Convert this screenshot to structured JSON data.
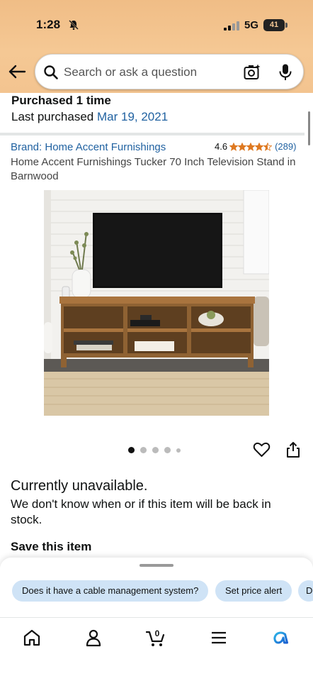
{
  "status_bar": {
    "time": "1:28",
    "network": "5G",
    "battery": "41"
  },
  "search": {
    "placeholder": "Search or ask a question",
    "value": ""
  },
  "purchase": {
    "count_text": "Purchased 1 time",
    "last_label": "Last purchased",
    "last_date": "Mar 19, 2021"
  },
  "product": {
    "brand": "Brand: Home Accent Furnishings",
    "rating_value": "4.6",
    "rating_stars": 4.5,
    "rating_count": "(289)",
    "title": "Home Accent Furnishings Tucker 70 Inch Television Stand in Barnwood",
    "image_count": 5,
    "active_image": 0
  },
  "availability": {
    "title": "Currently unavailable.",
    "text": "We don't know when or if this item will be back in stock."
  },
  "save": {
    "title": "Save this item"
  },
  "suggestions": [
    {
      "label": "Does it have a cable management system?"
    },
    {
      "label": "Set price alert"
    },
    {
      "label": "D"
    }
  ],
  "nav": {
    "cart_count": "0",
    "items": [
      "home-icon",
      "account-icon",
      "cart-icon",
      "menu-icon",
      "rufus-icon"
    ]
  },
  "colors": {
    "header": "#f5c894",
    "link": "#2162a1",
    "star": "#de7921",
    "chip": "#cfe3f6"
  }
}
